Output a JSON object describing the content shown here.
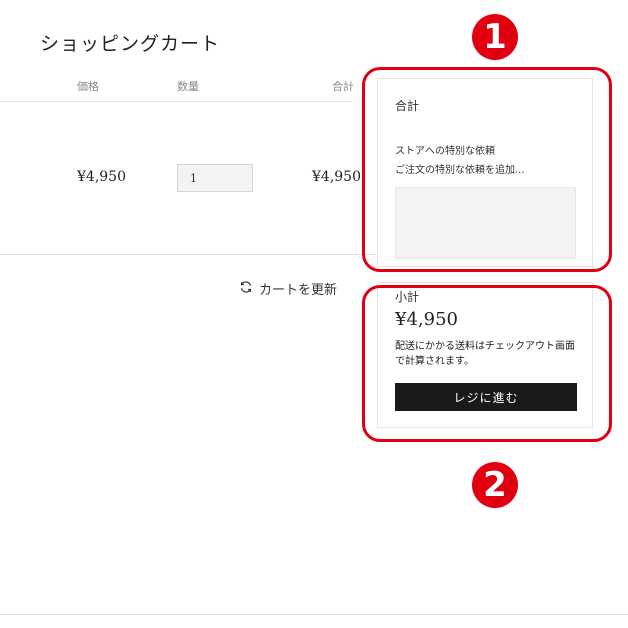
{
  "page": {
    "title": "ショッピングカート"
  },
  "table": {
    "headers": {
      "price": "価格",
      "quantity": "数量",
      "total": "合計"
    },
    "rows": [
      {
        "price": "¥4,950",
        "quantity": "1",
        "total": "¥4,950"
      }
    ]
  },
  "update_cart": {
    "label": "カートを更新",
    "icon": "refresh-icon"
  },
  "summary": {
    "heading": "合計",
    "note_label": "ストアへの特別な依頼",
    "note_placeholder": "ご注文の特別な依頼を追加..."
  },
  "checkout": {
    "subtotal_label": "小計",
    "subtotal_value": "¥4,950",
    "shipping_note": "配送にかかる送料はチェックアウト画面で計算されます。",
    "button_label": "レジに進む"
  },
  "annotations": {
    "badge_1": "1",
    "badge_2": "2",
    "color": "#e1000f"
  }
}
